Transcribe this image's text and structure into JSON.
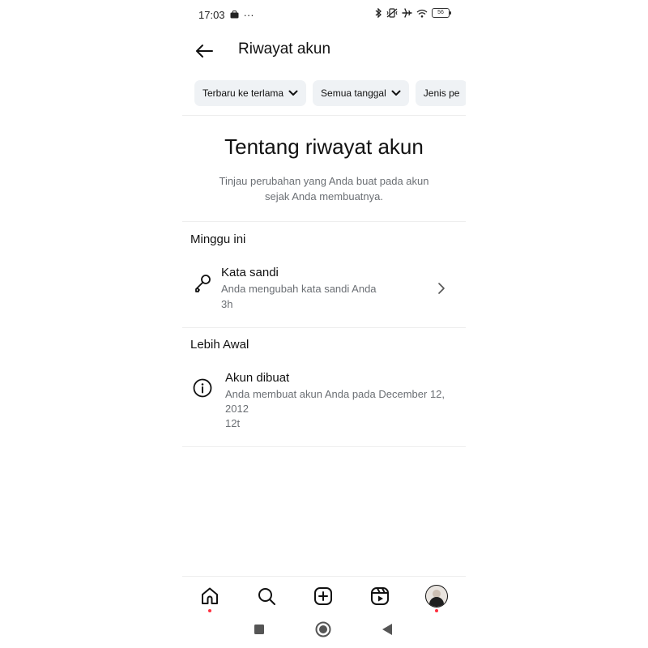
{
  "status_bar": {
    "time": "17:03",
    "dots": "···",
    "battery": "56"
  },
  "header": {
    "title": "Riwayat akun"
  },
  "filters": [
    {
      "label": "Terbaru ke terlama"
    },
    {
      "label": "Semua tanggal"
    },
    {
      "label": "Jenis pe"
    }
  ],
  "about": {
    "title": "Tentang riwayat akun",
    "description": "Tinjau perubahan yang Anda buat pada akun sejak Anda membuatnya."
  },
  "sections": [
    {
      "heading": "Minggu ini",
      "items": [
        {
          "title": "Kata sandi",
          "description": "Anda mengubah kata sandi Anda",
          "time": "3h",
          "icon": "key-icon"
        }
      ]
    },
    {
      "heading": "Lebih Awal",
      "items": [
        {
          "title": "Akun dibuat",
          "description": "Anda membuat akun Anda pada December 12, 2012",
          "time": "12t",
          "icon": "info-icon"
        }
      ]
    }
  ],
  "bottom_nav": {
    "icons": [
      "home-icon",
      "search-icon",
      "create-icon",
      "reels-icon",
      "profile-avatar"
    ],
    "notification_color": "#ff3040"
  },
  "system_nav": {
    "icons": [
      "recents-icon",
      "home-circle-icon",
      "back-triangle-icon"
    ]
  }
}
